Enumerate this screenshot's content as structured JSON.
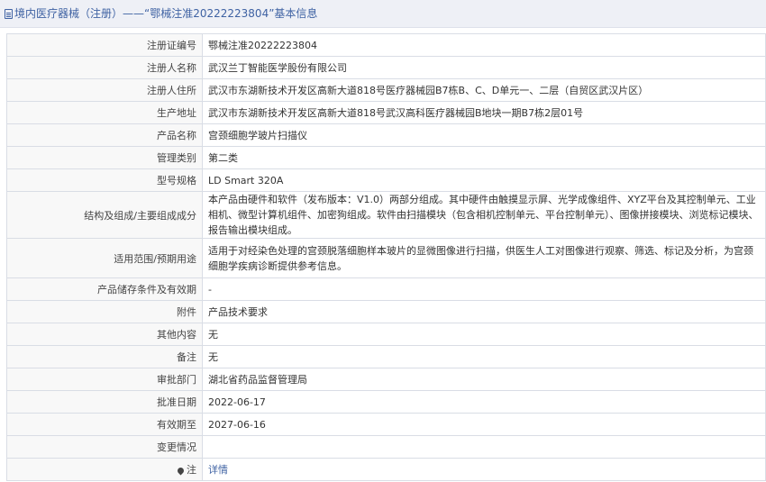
{
  "header": {
    "title": "境内医疗器械（注册）——“鄂械注准20222223804”基本信息"
  },
  "rows": [
    {
      "label": "注册证编号",
      "value": "鄂械注准20222223804"
    },
    {
      "label": "注册人名称",
      "value": "武汉兰丁智能医学股份有限公司"
    },
    {
      "label": "注册人住所",
      "value": "武汉市东湖新技术开发区高新大道818号医疗器械园B7栋B、C、D单元一、二层（自贸区武汉片区）"
    },
    {
      "label": "生产地址",
      "value": "武汉市东湖新技术开发区高新大道818号武汉高科医疗器械园B地块一期B7栋2层01号"
    },
    {
      "label": "产品名称",
      "value": "宫颈细胞学玻片扫描仪"
    },
    {
      "label": "管理类别",
      "value": "第二类"
    },
    {
      "label": "型号规格",
      "value": "LD Smart 320A"
    },
    {
      "label": "结构及组成/主要组成成分",
      "value": "本产品由硬件和软件（发布版本：V1.0）两部分组成。其中硬件由触摸显示屏、光学成像组件、XYZ平台及其控制单元、工业相机、微型计算机组件、加密狗组成。软件由扫描模块（包含相机控制单元、平台控制单元）、图像拼接模块、浏览标记模块、报告输出模块组成。"
    },
    {
      "label": "适用范围/预期用途",
      "value": "适用于对经染色处理的宫颈脱落细胞样本玻片的显微图像进行扫描，供医生人工对图像进行观察、筛选、标记及分析，为宫颈细胞学疾病诊断提供参考信息。"
    },
    {
      "label": "产品储存条件及有效期",
      "value": "-"
    },
    {
      "label": "附件",
      "value": "产品技术要求"
    },
    {
      "label": "其他内容",
      "value": "无"
    },
    {
      "label": "备注",
      "value": "无"
    },
    {
      "label": "审批部门",
      "value": "湖北省药品监督管理局"
    },
    {
      "label": "批准日期",
      "value": "2022-06-17"
    },
    {
      "label": "有效期至",
      "value": "2027-06-16"
    },
    {
      "label": "变更情况",
      "value": ""
    }
  ],
  "note": {
    "icon": "pin-icon",
    "label": "注",
    "link_text": "详情"
  }
}
